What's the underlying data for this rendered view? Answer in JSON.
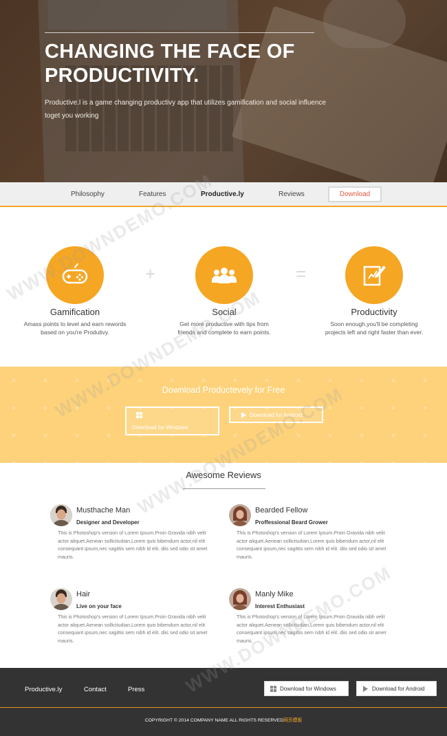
{
  "hero": {
    "title": "CHANGING THE FACE OF PRODUCTIVITY.",
    "description": "Productive.l is a game changing productivy app that utilizes gamification and social influence toget you working"
  },
  "nav": {
    "items": [
      "Philosophy",
      "Features",
      "Productive.ly",
      "Reviews"
    ],
    "download_label": "Download",
    "download_color": "#e05a3b"
  },
  "features": [
    {
      "title": "Gamification",
      "description": "Amass points to level and earn rewords based on you're Produtivy.",
      "icon": "gamepad-icon"
    },
    {
      "title": "Social",
      "description": "Get more productive with tips from friends and complete to earn points.",
      "icon": "people-icon"
    },
    {
      "title": "Productivity",
      "description": "Soon enough,you'll be completing projects left and right faster than ever.",
      "icon": "edit-note-icon"
    }
  ],
  "operators": {
    "plus": "+",
    "equals": "="
  },
  "download_band": {
    "title": "Download Productevely for Free",
    "windows_label": "Download for Windows",
    "android_label": "Download for Android",
    "color": "#fdd27a"
  },
  "reviews": {
    "title": "Awesome Reviews",
    "items": [
      {
        "name": "Musthache Man",
        "role": "Designer and Developer",
        "text": "This is Photoshop's version of Lorem Ipsum.Proin Gravida nibh velit actor aliquet.Aenean sollicitudian,Lorem quis bibendum actor,nil elit consequant ipsum,nec sagittis sem nibh id elit. diis sed odio sit amet mauris."
      },
      {
        "name": "Bearded Fellow",
        "role": "Proffessional Beard Grower",
        "text": "This is Photoshop's version of Lorem Ipsum.Proin Gravida nibh velit actor aliquet.Aenean sollicitudian,Lorem quis bibendum actor,nil elit consequant ipsum,nec sagittis sem nibh id elit. diis sed odio sit amet mauris."
      },
      {
        "name": "Hair",
        "role": "Live on your face",
        "text": "This is Photoshop's version of Lorem Ipsum.Proin Gravida nibh velit actor aliquet.Aenean sollicitudian,Lorem quis bibendum actor,nil elit consequant ipsum,nec sagittis sem nibh id elit. diis sed odio sit amet mauris."
      },
      {
        "name": "Manly Mike",
        "role": "Interest Enthusiast",
        "text": "This is Photoshop's version of Lorem Ipsum.Proin Gravida nibh velit actor aliquet.Aenean sollicitudian,Lorem quis bibendum actor,nil elit consequant ipsum,nec sagittis sem nibh id elit. diis sed odio sit amet mauris."
      }
    ]
  },
  "footer": {
    "links": [
      "Productive.ly",
      "Contact",
      "Press"
    ],
    "windows_label": "Download for Windows",
    "android_label": "Download for Android",
    "copyright": "COPYRIGHT © 2014 COMPANY NAME ALL RIGHTS RESERVED",
    "copyright_accent": "网页模板"
  },
  "watermark": "WWW.DOWNDEMO.COM",
  "colors": {
    "accent": "#f5a623",
    "footer_bg": "#333333",
    "nav_bg": "#efefef"
  }
}
